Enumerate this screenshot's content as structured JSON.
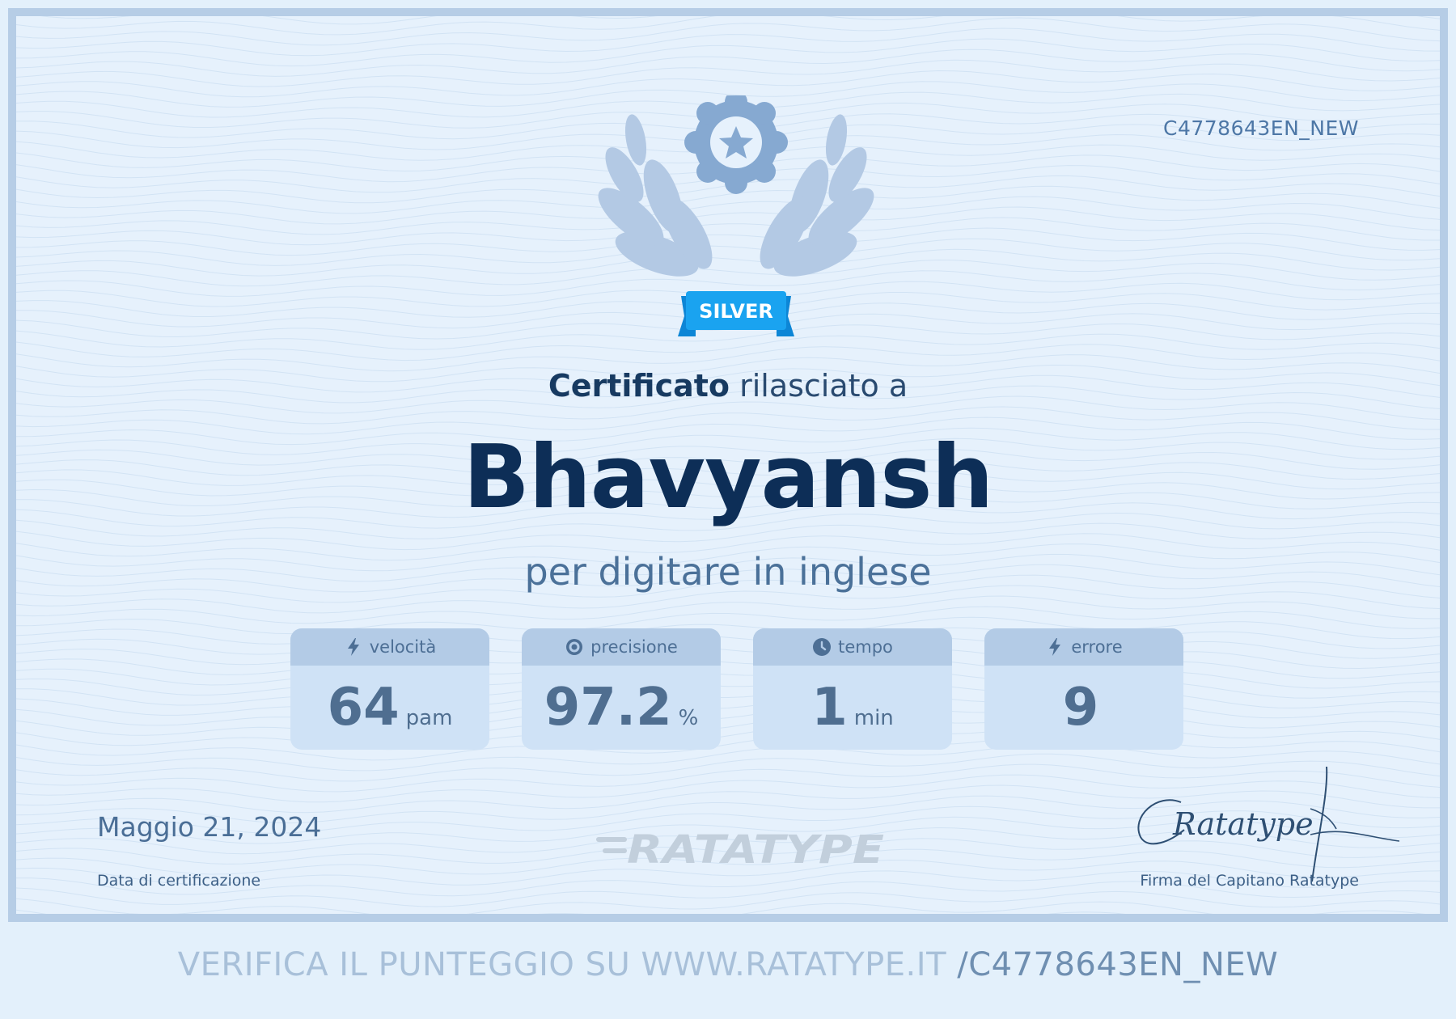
{
  "certificate": {
    "id": "C4778643EN_NEW",
    "badge_label": "SILVER",
    "heading_strong": "Certificato",
    "heading_rest": " rilasciato a",
    "recipient_name": "Bhavyansh",
    "subline": "per digitare in inglese"
  },
  "stats": [
    {
      "icon": "lightning-icon",
      "label": "velocità",
      "value": "64",
      "unit": "pam"
    },
    {
      "icon": "target-icon",
      "label": "precisione",
      "value": "97.2",
      "unit": "%"
    },
    {
      "icon": "clock-icon",
      "label": "tempo",
      "value": "1",
      "unit": "min"
    },
    {
      "icon": "lightning-icon",
      "label": "errore",
      "value": "9",
      "unit": ""
    }
  ],
  "footer": {
    "date": "Maggio 21, 2024",
    "date_label": "Data di certificazione",
    "brand": "RATATYPE",
    "signature_text": "Ratatype",
    "signature_label": "Firma del Capitano Ratatype"
  },
  "verify": {
    "prefix": "VERIFICA IL PUNTEGGIO SU WWW.RATATYPE.IT ",
    "code": "/C4778643EN_NEW"
  },
  "colors": {
    "page_bg": "#e3f0fb",
    "border": "#b6cde6",
    "badge_ribbon": "#1aa3f0",
    "name": "#0d2e57"
  }
}
